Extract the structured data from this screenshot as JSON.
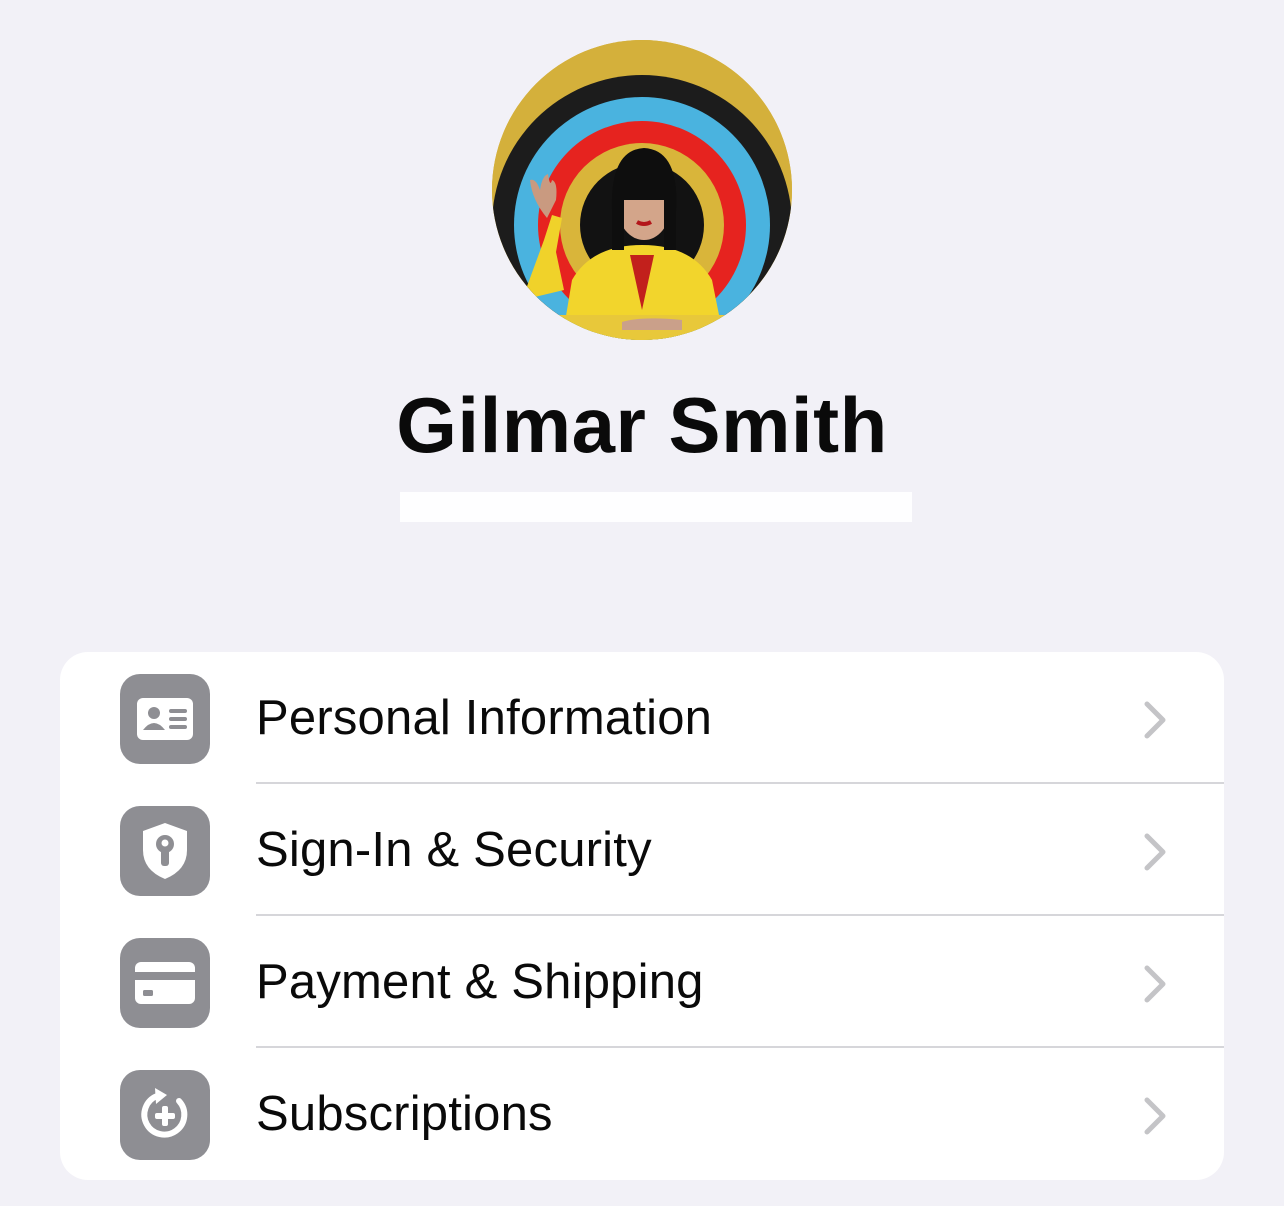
{
  "profile": {
    "name": "Gilmar Smith"
  },
  "menu": [
    {
      "label": "Personal Information",
      "icon": "contact-card-icon"
    },
    {
      "label": "Sign-In & Security",
      "icon": "shield-key-icon"
    },
    {
      "label": "Payment & Shipping",
      "icon": "credit-card-icon"
    },
    {
      "label": "Subscriptions",
      "icon": "subscription-add-icon"
    }
  ],
  "colors": {
    "background": "#f2f1f7",
    "icon_tile": "#8e8e93",
    "chevron": "#c4c4c7"
  }
}
